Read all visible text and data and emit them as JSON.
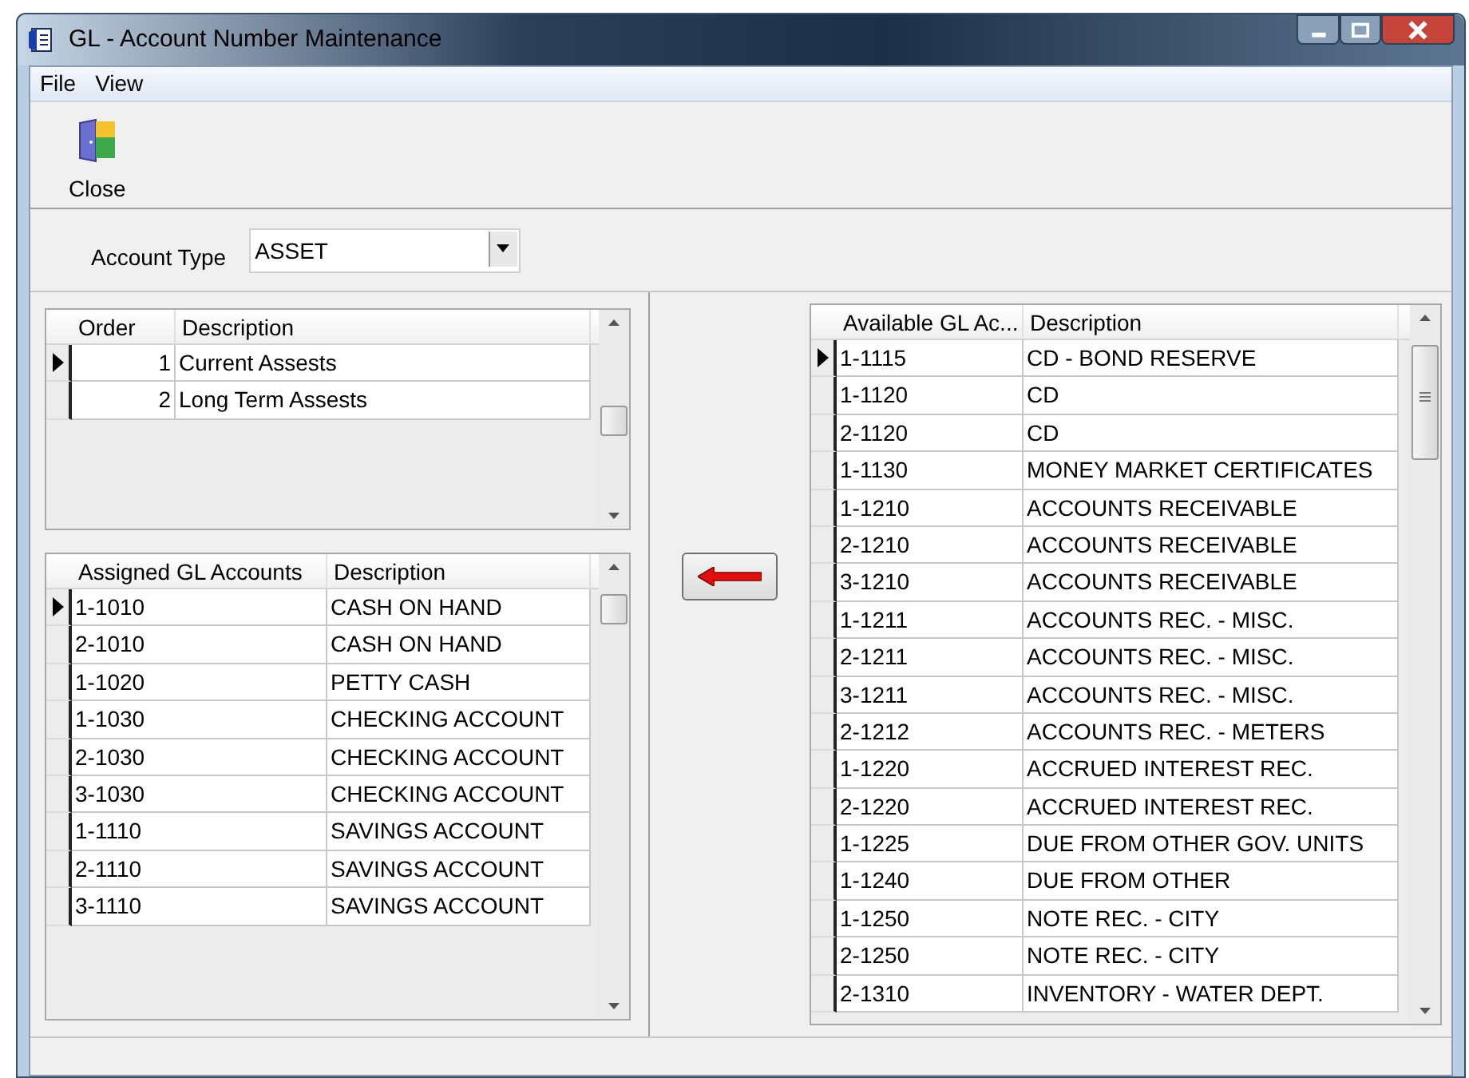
{
  "window": {
    "title": "GL - Account Number Maintenance"
  },
  "menu": [
    "File",
    "View"
  ],
  "toolbar": [
    {
      "label": "Close"
    }
  ],
  "account_type": {
    "label": "Account Type",
    "value": "ASSET"
  },
  "order_table": {
    "columns": [
      "Order",
      "Description"
    ],
    "rows": [
      {
        "cells": [
          "1",
          "Current Assests"
        ],
        "selected": true
      },
      {
        "cells": [
          "2",
          "Long Term Assests"
        ],
        "selected": false
      }
    ]
  },
  "assigned_table": {
    "columns": [
      "Assigned GL Accounts",
      "Description"
    ],
    "rows": [
      {
        "cells": [
          "1-1010",
          "CASH ON HAND"
        ],
        "selected": true
      },
      {
        "cells": [
          "2-1010",
          "CASH ON HAND"
        ],
        "selected": false
      },
      {
        "cells": [
          "1-1020",
          "PETTY CASH"
        ],
        "selected": false
      },
      {
        "cells": [
          "1-1030",
          "CHECKING ACCOUNT"
        ],
        "selected": false
      },
      {
        "cells": [
          "2-1030",
          "CHECKING ACCOUNT"
        ],
        "selected": false
      },
      {
        "cells": [
          "3-1030",
          "CHECKING ACCOUNT"
        ],
        "selected": false
      },
      {
        "cells": [
          "1-1110",
          "SAVINGS ACCOUNT"
        ],
        "selected": false
      },
      {
        "cells": [
          "2-1110",
          "SAVINGS ACCOUNT"
        ],
        "selected": false
      },
      {
        "cells": [
          "3-1110",
          "SAVINGS ACCOUNT"
        ],
        "selected": false
      }
    ]
  },
  "available_table": {
    "columns": [
      "Available GL Ac...",
      "Description"
    ],
    "rows": [
      {
        "cells": [
          "1-1115",
          "CD - BOND RESERVE"
        ],
        "selected": true
      },
      {
        "cells": [
          "1-1120",
          "CD"
        ],
        "selected": false
      },
      {
        "cells": [
          "2-1120",
          "CD"
        ],
        "selected": false
      },
      {
        "cells": [
          "1-1130",
          "MONEY MARKET CERTIFICATES"
        ],
        "selected": false
      },
      {
        "cells": [
          "1-1210",
          "ACCOUNTS RECEIVABLE"
        ],
        "selected": false
      },
      {
        "cells": [
          "2-1210",
          "ACCOUNTS RECEIVABLE"
        ],
        "selected": false
      },
      {
        "cells": [
          "3-1210",
          "ACCOUNTS RECEIVABLE"
        ],
        "selected": false
      },
      {
        "cells": [
          "1-1211",
          "ACCOUNTS REC. - MISC."
        ],
        "selected": false
      },
      {
        "cells": [
          "2-1211",
          "ACCOUNTS REC. - MISC."
        ],
        "selected": false
      },
      {
        "cells": [
          "3-1211",
          "ACCOUNTS REC. - MISC."
        ],
        "selected": false
      },
      {
        "cells": [
          "2-1212",
          "ACCOUNTS REC. - METERS"
        ],
        "selected": false
      },
      {
        "cells": [
          "1-1220",
          "ACCRUED INTEREST REC."
        ],
        "selected": false
      },
      {
        "cells": [
          "2-1220",
          "ACCRUED INTEREST REC."
        ],
        "selected": false
      },
      {
        "cells": [
          "1-1225",
          "DUE FROM OTHER GOV. UNITS"
        ],
        "selected": false
      },
      {
        "cells": [
          "1-1240",
          "DUE FROM OTHER"
        ],
        "selected": false
      },
      {
        "cells": [
          "1-1250",
          "NOTE REC. - CITY"
        ],
        "selected": false
      },
      {
        "cells": [
          "2-1250",
          "NOTE REC. - CITY"
        ],
        "selected": false
      },
      {
        "cells": [
          "2-1310",
          "INVENTORY - WATER DEPT."
        ],
        "selected": false
      }
    ]
  }
}
